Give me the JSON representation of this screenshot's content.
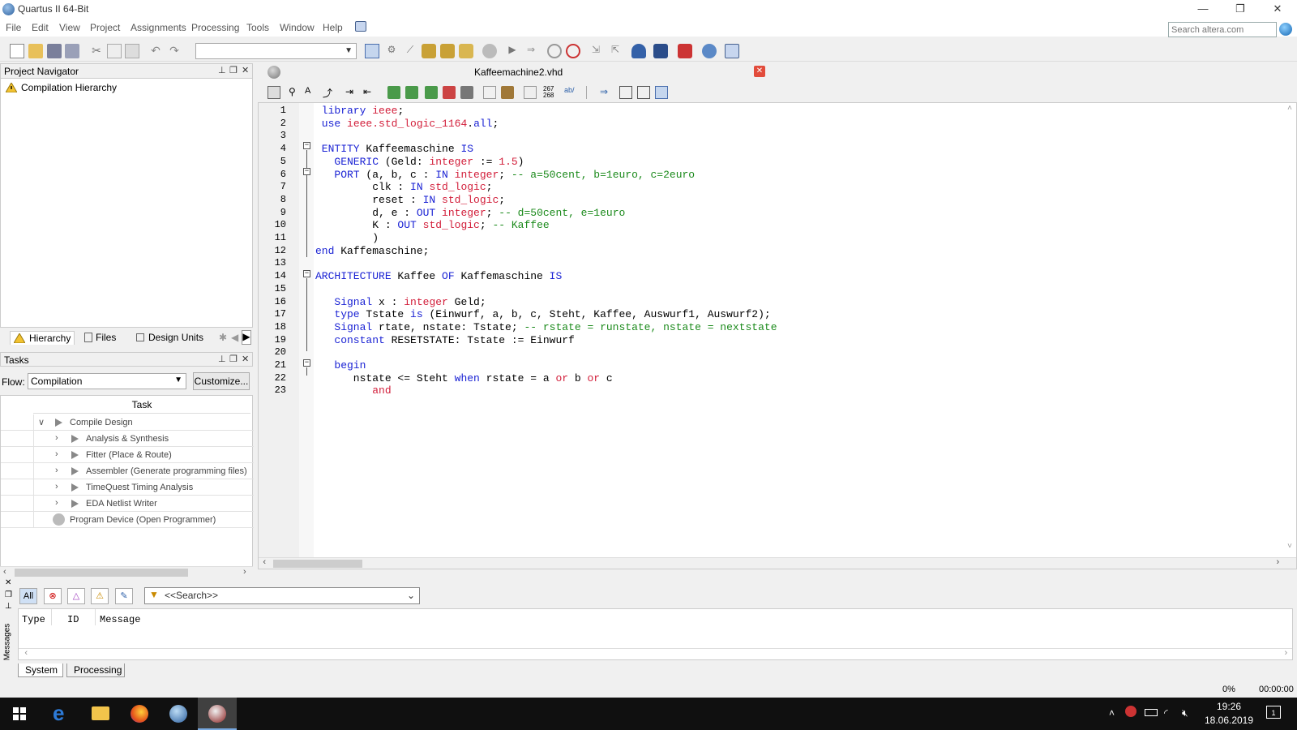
{
  "window": {
    "title": "Quartus II 64-Bit",
    "minimize": "—",
    "restore": "❐",
    "close": "✕"
  },
  "menu": [
    "File",
    "Edit",
    "View",
    "Project",
    "Assignments",
    "Processing",
    "Tools",
    "Window",
    "Help"
  ],
  "search": {
    "placeholder": "Search altera.com"
  },
  "navigator": {
    "title": "Project Navigator",
    "root": "Compilation Hierarchy",
    "tabs": [
      "Hierarchy",
      "Files",
      "Design Units"
    ]
  },
  "tasks": {
    "title": "Tasks",
    "flow_label": "Flow:",
    "flow_value": "Compilation",
    "customize": "Customize...",
    "column": "Task",
    "rows": [
      {
        "label": "Compile Design",
        "expand": "∨"
      },
      {
        "label": "Analysis & Synthesis",
        "expand": "›"
      },
      {
        "label": "Fitter (Place & Route)",
        "expand": "›"
      },
      {
        "label": "Assembler (Generate programming files)",
        "expand": "›"
      },
      {
        "label": "TimeQuest Timing Analysis",
        "expand": "›"
      },
      {
        "label": "EDA Netlist Writer",
        "expand": "›"
      },
      {
        "label": "Program Device (Open Programmer)",
        "expand": ""
      }
    ]
  },
  "editor": {
    "filename": "Kaffeemachine2.vhd",
    "line_numbers": [
      "1",
      "2",
      "3",
      "4",
      "5",
      "6",
      "7",
      "8",
      "9",
      "10",
      "11",
      "12",
      "13",
      "14",
      "15",
      "16",
      "17",
      "18",
      "19",
      "20",
      "21",
      "22",
      "23"
    ],
    "lines": [
      [
        {
          "t": " library ",
          "c": "kw"
        },
        {
          "t": "ieee",
          "c": "ty"
        },
        {
          "t": ";",
          "c": ""
        }
      ],
      [
        {
          "t": " use ",
          "c": "kw"
        },
        {
          "t": "ieee.std_logic_1164",
          "c": "ty"
        },
        {
          "t": ".",
          "c": ""
        },
        {
          "t": "all",
          "c": "kw"
        },
        {
          "t": ";",
          "c": ""
        }
      ],
      [],
      [
        {
          "t": " ENTITY ",
          "c": "kw"
        },
        {
          "t": "Kaffeemaschine ",
          "c": ""
        },
        {
          "t": "IS",
          "c": "kw"
        }
      ],
      [
        {
          "t": "   GENERIC ",
          "c": "kw"
        },
        {
          "t": "(Geld: ",
          "c": ""
        },
        {
          "t": "integer",
          "c": "ty"
        },
        {
          "t": " := ",
          "c": ""
        },
        {
          "t": "1.5",
          "c": "nm"
        },
        {
          "t": ")",
          "c": ""
        }
      ],
      [
        {
          "t": "   PORT ",
          "c": "kw"
        },
        {
          "t": "(a, b, c : ",
          "c": ""
        },
        {
          "t": "IN ",
          "c": "kw"
        },
        {
          "t": "integer",
          "c": "ty"
        },
        {
          "t": "; ",
          "c": ""
        },
        {
          "t": "-- a=50cent, b=1euro, c=2euro",
          "c": "cm"
        }
      ],
      [
        {
          "t": "         clk : ",
          "c": ""
        },
        {
          "t": "IN ",
          "c": "kw"
        },
        {
          "t": "std_logic",
          "c": "ty"
        },
        {
          "t": ";",
          "c": ""
        }
      ],
      [
        {
          "t": "         reset : ",
          "c": ""
        },
        {
          "t": "IN ",
          "c": "kw"
        },
        {
          "t": "std_logic",
          "c": "ty"
        },
        {
          "t": ";",
          "c": ""
        }
      ],
      [
        {
          "t": "         d, e : ",
          "c": ""
        },
        {
          "t": "OUT ",
          "c": "kw"
        },
        {
          "t": "integer",
          "c": "ty"
        },
        {
          "t": "; ",
          "c": ""
        },
        {
          "t": "-- d=50cent, e=1euro",
          "c": "cm"
        }
      ],
      [
        {
          "t": "         K : ",
          "c": ""
        },
        {
          "t": "OUT ",
          "c": "kw"
        },
        {
          "t": "std_logic",
          "c": "ty"
        },
        {
          "t": "; ",
          "c": ""
        },
        {
          "t": "-- Kaffee",
          "c": "cm"
        }
      ],
      [
        {
          "t": "         )",
          "c": ""
        }
      ],
      [
        {
          "t": "end ",
          "c": "kw"
        },
        {
          "t": "Kaffemaschine;",
          "c": ""
        }
      ],
      [],
      [
        {
          "t": "ARCHITECTURE ",
          "c": "kw"
        },
        {
          "t": "Kaffee ",
          "c": ""
        },
        {
          "t": "OF ",
          "c": "kw"
        },
        {
          "t": "Kaffemaschine ",
          "c": ""
        },
        {
          "t": "IS",
          "c": "kw"
        }
      ],
      [],
      [
        {
          "t": "   Signal ",
          "c": "kw"
        },
        {
          "t": "x : ",
          "c": ""
        },
        {
          "t": "integer ",
          "c": "ty"
        },
        {
          "t": "Geld;",
          "c": ""
        }
      ],
      [
        {
          "t": "   type ",
          "c": "kw"
        },
        {
          "t": "Tstate ",
          "c": ""
        },
        {
          "t": "is ",
          "c": "kw"
        },
        {
          "t": "(Einwurf, a, b, c, Steht, Kaffee, Auswurf1, Auswurf2);",
          "c": ""
        }
      ],
      [
        {
          "t": "   Signal ",
          "c": "kw"
        },
        {
          "t": "rtate, nstate: Tstate; ",
          "c": ""
        },
        {
          "t": "-- rstate = runstate, nstate = nextstate",
          "c": "cm"
        }
      ],
      [
        {
          "t": "   constant ",
          "c": "kw"
        },
        {
          "t": "RESETSTATE: Tstate := Einwurf",
          "c": ""
        }
      ],
      [],
      [
        {
          "t": "   begin",
          "c": "kw"
        }
      ],
      [
        {
          "t": "      nstate <= Steht ",
          "c": ""
        },
        {
          "t": "when ",
          "c": "kw"
        },
        {
          "t": "rstate = a ",
          "c": ""
        },
        {
          "t": "or ",
          "c": "ty"
        },
        {
          "t": "b ",
          "c": ""
        },
        {
          "t": "or ",
          "c": "ty"
        },
        {
          "t": "c",
          "c": ""
        }
      ],
      [
        {
          "t": "         ",
          "c": ""
        },
        {
          "t": "and",
          "c": "ty"
        }
      ]
    ]
  },
  "messages": {
    "filter_all": "All",
    "search_placeholder": "<<Search>>",
    "columns": [
      "Type",
      "ID",
      "Message"
    ],
    "tabs": [
      "System",
      "Processing"
    ],
    "side_label": "Messages"
  },
  "status": {
    "progress": "0%",
    "elapsed": "00:00:00"
  },
  "taskbar": {
    "time": "19:26",
    "date": "18.06.2019",
    "notifications": "1"
  },
  "colors": {
    "keyword": "#1a22d4",
    "type": "#d21e3a",
    "comment": "#1b8a1b"
  }
}
